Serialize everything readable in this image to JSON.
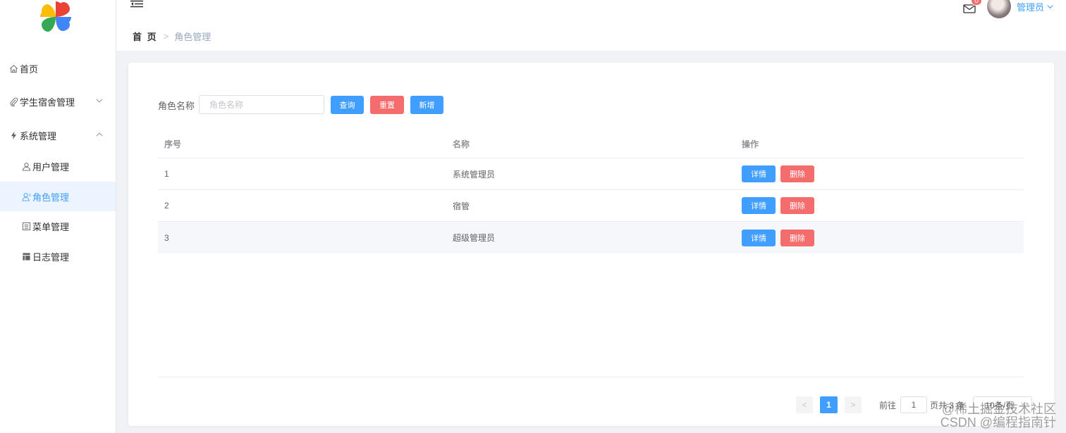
{
  "sidebar": {
    "items": [
      {
        "label": "首页",
        "icon": "home-icon"
      },
      {
        "label": "学生宿舍管理",
        "icon": "paperclip-icon"
      },
      {
        "label": "系统管理",
        "icon": "lightning-icon"
      },
      {
        "label": "用户管理",
        "icon": "user-icon"
      },
      {
        "label": "角色管理",
        "icon": "user-role-icon"
      },
      {
        "label": "菜单管理",
        "icon": "menu-list-icon"
      },
      {
        "label": "日志管理",
        "icon": "table-icon"
      }
    ]
  },
  "header": {
    "breadcrumb_home": "首 页",
    "breadcrumb_sep": ">",
    "breadcrumb_current": "角色管理",
    "badge_count": "0",
    "user_name": "管理员"
  },
  "search": {
    "label": "角色名称",
    "placeholder": "角色名称",
    "query_label": "查询",
    "reset_label": "重置",
    "add_label": "新增"
  },
  "table": {
    "headers": {
      "index": "序号",
      "name": "名称",
      "ops": "操作"
    },
    "detail_label": "详情",
    "delete_label": "删除",
    "rows": [
      {
        "index": "1",
        "name": "系统管理员"
      },
      {
        "index": "2",
        "name": "宿管"
      },
      {
        "index": "3",
        "name": "超级管理员"
      }
    ]
  },
  "pagination": {
    "prev": "<",
    "page": "1",
    "next": ">",
    "goto_label": "前往",
    "goto_value": "1",
    "total_text": "页共 3 条",
    "page_size": "10条/页"
  },
  "watermark": {
    "line1": "@稀土掘金技术社区",
    "line2": "CSDN @编程指南针"
  },
  "colors": {
    "primary": "#409eff",
    "danger": "#f56c6c",
    "active_bg": "#ecf5ff"
  }
}
